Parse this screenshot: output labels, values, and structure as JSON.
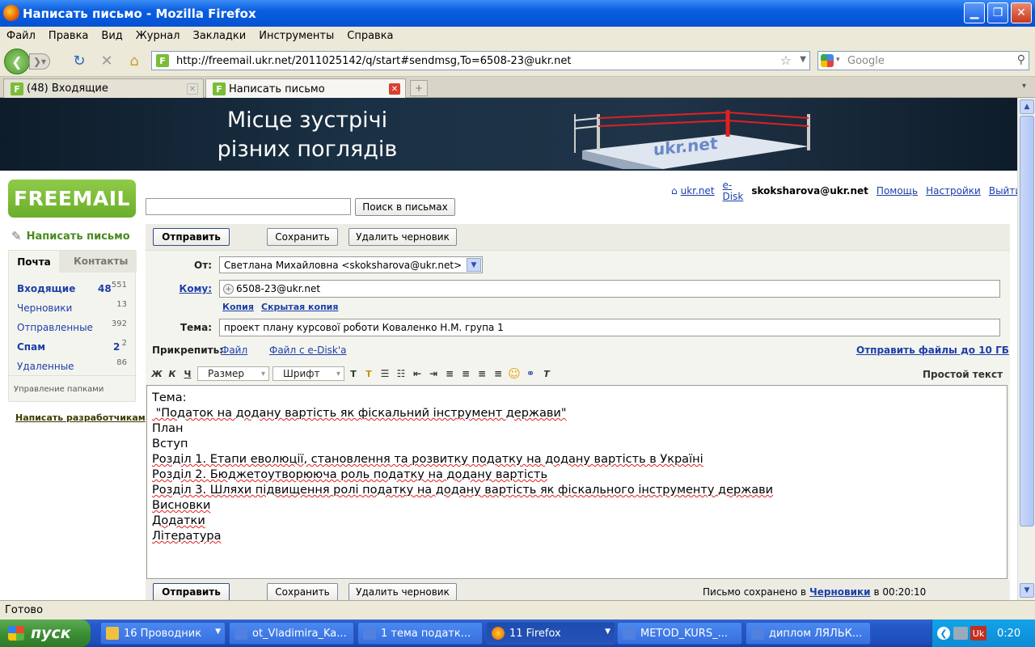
{
  "window": {
    "title": "Написать письмо - Mozilla Firefox"
  },
  "menu": [
    "Файл",
    "Правка",
    "Вид",
    "Журнал",
    "Закладки",
    "Инструменты",
    "Справка"
  ],
  "nav": {
    "url": "http://freemail.ukr.net/2011025142/q/start#sendmsg,To=6508-23@ukr.net",
    "search_placeholder": "Google"
  },
  "tabs": [
    {
      "label": "(48) Входящие",
      "active": false
    },
    {
      "label": "Написать письмо",
      "active": true
    }
  ],
  "banner": {
    "line1": "Місце зустрічі",
    "line2": "різних поглядів",
    "brand": "ukr.net"
  },
  "logo": "FREEMAIL",
  "top_links": {
    "ukrnet": "ukr.net",
    "edisk": "e-Disk",
    "user": "skoksharova@ukr.net",
    "help": "Помощь",
    "settings": "Настройки",
    "logout": "Выйти"
  },
  "search": {
    "value": "",
    "button": "Поиск в письмах"
  },
  "sidebar": {
    "compose": "Написать письмо",
    "tab_mail": "Почта",
    "tab_contacts": "Контакты",
    "folders": [
      {
        "name": "Входящие",
        "unread": "48",
        "total": "551",
        "bold": true
      },
      {
        "name": "Черновики",
        "unread": "",
        "total": "13",
        "bold": false
      },
      {
        "name": "Отправленные",
        "unread": "",
        "total": "392",
        "bold": false
      },
      {
        "name": "Спам",
        "unread": "2",
        "total": "2",
        "bold": true
      },
      {
        "name": "Удаленные",
        "unread": "",
        "total": "86",
        "bold": false
      }
    ],
    "manage": "Управление папками",
    "write_dev": "Написать разработчикам"
  },
  "toolbar": {
    "send": "Отправить",
    "save": "Сохранить",
    "delete_draft": "Удалить черновик"
  },
  "form": {
    "from_label": "От:",
    "from_value": "Светлана Михайловна <skoksharova@ukr.net>",
    "to_label": "Кому:",
    "to_value": "6508-23@ukr.net",
    "cc": "Копия",
    "bcc": "Скрытая копия",
    "subject_label": "Тема:",
    "subject_value": "проект плану  курсової роботи Коваленко Н.М. група 1",
    "attach_label": "Прикрепить:",
    "attach_file": "Файл",
    "attach_edisk": "Файл с e-Disk'a",
    "send_files": "Отправить файлы до 10 ГБ"
  },
  "editor_toolbar": {
    "bold": "Ж",
    "italic": "К",
    "underline": "Ч",
    "size": "Размер",
    "font": "Шрифт",
    "plain": "Простой текст"
  },
  "body_lines": [
    "Тема:",
    " \"Податок на додану вартість як фіскальний інструмент держави\"",
    "План",
    "Вступ",
    "Розділ 1. Етапи еволюції, становлення та розвитку податку на додану вартість в Україні",
    "Розділ 2. Бюджетоутворююча роль податку на додану вартість",
    "Розділ 3. Шляхи підвищення ролі податку на додану вартість як фіскального інструменту держави",
    "Висновки",
    "Додатки",
    "Література"
  ],
  "saved": {
    "prefix": "Письмо сохранено в",
    "folder": "Черновики",
    "suffix": "в 00:20:10"
  },
  "status": "Готово",
  "taskbar": {
    "start": "пуск",
    "items": [
      {
        "label": "16 Проводник",
        "color": "#f0c040"
      },
      {
        "label": "ot_Vladimira_Ka...",
        "color": "#5080e0"
      },
      {
        "label": "1 тема податк...",
        "color": "#5080e0"
      },
      {
        "label": "11 Firefox",
        "color": "#e66000"
      },
      {
        "label": "METOD_KURS_...",
        "color": "#5080e0"
      },
      {
        "label": "диплом ЛЯЛЬК...",
        "color": "#5080e0"
      }
    ],
    "lang": "Uk",
    "clock": "0:20"
  }
}
